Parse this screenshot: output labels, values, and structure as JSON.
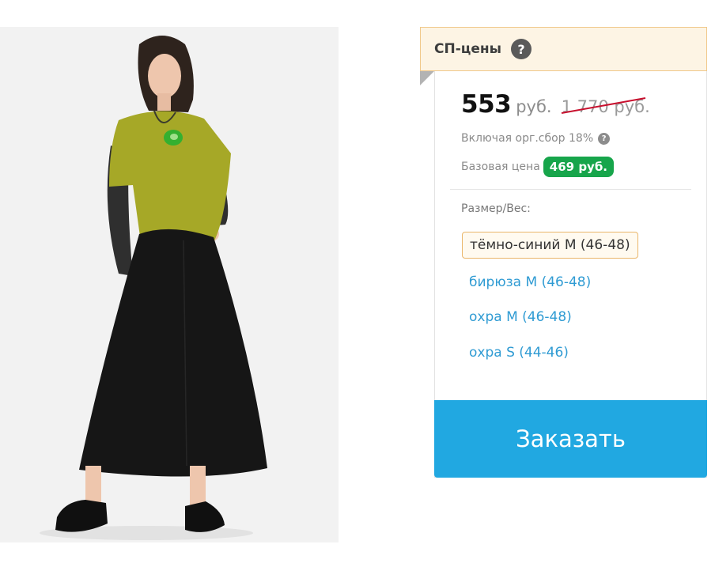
{
  "product": {
    "image_alt": "Модель в горчичной кофте с сетчатыми рукавами, чёрной юбке и лоферах"
  },
  "sp": {
    "title": "СП-цены",
    "help": "?"
  },
  "pricing": {
    "price": "553",
    "currency": "руб.",
    "old_price": "1 770 руб.",
    "fee_text": "Включая орг.сбор 18%",
    "fee_help": "?",
    "base_label": "Базовая цена",
    "base_price": "469 руб."
  },
  "sizes": {
    "label": "Размер/Вес:",
    "options": [
      {
        "label": "тёмно-синий M (46-48)",
        "selected": true
      },
      {
        "label": "бирюза M (46-48)",
        "selected": false
      },
      {
        "label": "охра M (46-48)",
        "selected": false
      },
      {
        "label": "охра S (44-46)",
        "selected": false
      }
    ]
  },
  "order": {
    "label": "Заказать"
  },
  "colors": {
    "accent": "#21a8e1",
    "badge_green": "#17a54b",
    "link_blue": "#2f9bd3",
    "strike_red": "#c8102e",
    "header_bg": "#fdf4e4"
  }
}
